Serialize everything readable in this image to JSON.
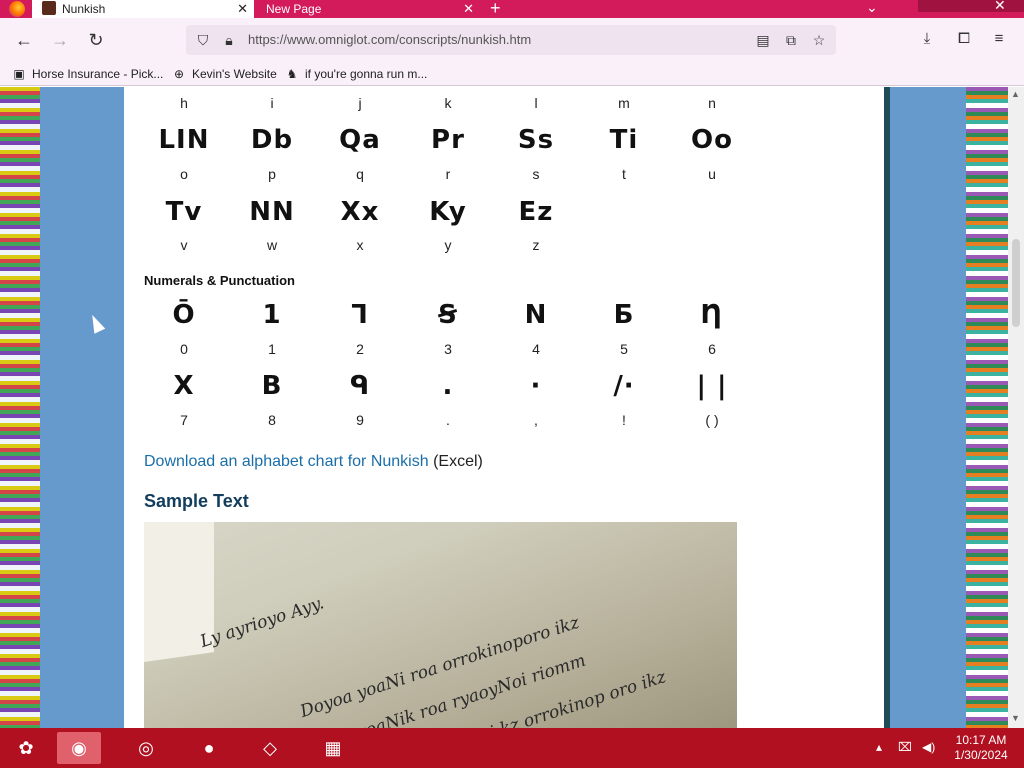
{
  "browser": {
    "tabs": [
      {
        "label": "Nunkish",
        "active": true
      },
      {
        "label": "New Page",
        "active": false
      }
    ],
    "url": "https://www.omniglot.com/conscripts/nunkish.htm",
    "bookmarks": [
      {
        "label": "Horse Insurance - Pick...",
        "icon": "bookmark-page-icon"
      },
      {
        "label": "Kevin's Website",
        "icon": "globe-icon"
      },
      {
        "label": "if you're gonna run m...",
        "icon": "animal-icon"
      }
    ]
  },
  "alphabet": {
    "row1_labels": [
      "h",
      "i",
      "j",
      "k",
      "l",
      "m",
      "n"
    ],
    "row2_glyphs": [
      "LIN",
      "Db",
      "Qa",
      "Pr",
      "Ss",
      "Ti",
      "Oo"
    ],
    "row2_labels": [
      "o",
      "p",
      "q",
      "r",
      "s",
      "t",
      "u"
    ],
    "row3_glyphs": [
      "Tv",
      "NN",
      "Xx",
      "Ky",
      "Ez"
    ],
    "row3_labels": [
      "v",
      "w",
      "x",
      "y",
      "z"
    ]
  },
  "numerals": {
    "heading": "Numerals & Punctuation",
    "row1_glyphs": [
      "Ō",
      "1",
      "Ꞁ",
      "Ꞩ",
      "N",
      "Ƃ",
      "Ƞ"
    ],
    "row1_labels": [
      "0",
      "1",
      "2",
      "3",
      "4",
      "5",
      "6"
    ],
    "row2_glyphs": [
      "X",
      "B",
      "ᑫ",
      ".",
      "·",
      "/·",
      "| |"
    ],
    "row2_labels": [
      "7",
      "8",
      "9",
      ".",
      ",",
      "!",
      "( )"
    ]
  },
  "download": {
    "link_text": "Download an alphabet chart for Nunkish",
    "suffix": "(Excel)"
  },
  "sample": {
    "heading": "Sample Text",
    "handwriting_lines": [
      "Ly ayrioyo Ayy.",
      "Doyoa yoaNi roa orrokinoporo ikz",
      "Doyoa yoaNik roa ryaoyNoi riomm",
      "Doyoa Noyi kz orrokinop oro ikz"
    ]
  },
  "taskbar": {
    "time": "10:17 AM",
    "date": "1/30/2024",
    "apps": [
      "firefox",
      "chrome",
      "obs-studio",
      "virtualbox",
      "windows-xp"
    ]
  },
  "colors": {
    "tabbar": "#d31a5a",
    "page_background": "#6699cc",
    "link": "#1a6ea8",
    "taskbar": "#b0101f"
  }
}
